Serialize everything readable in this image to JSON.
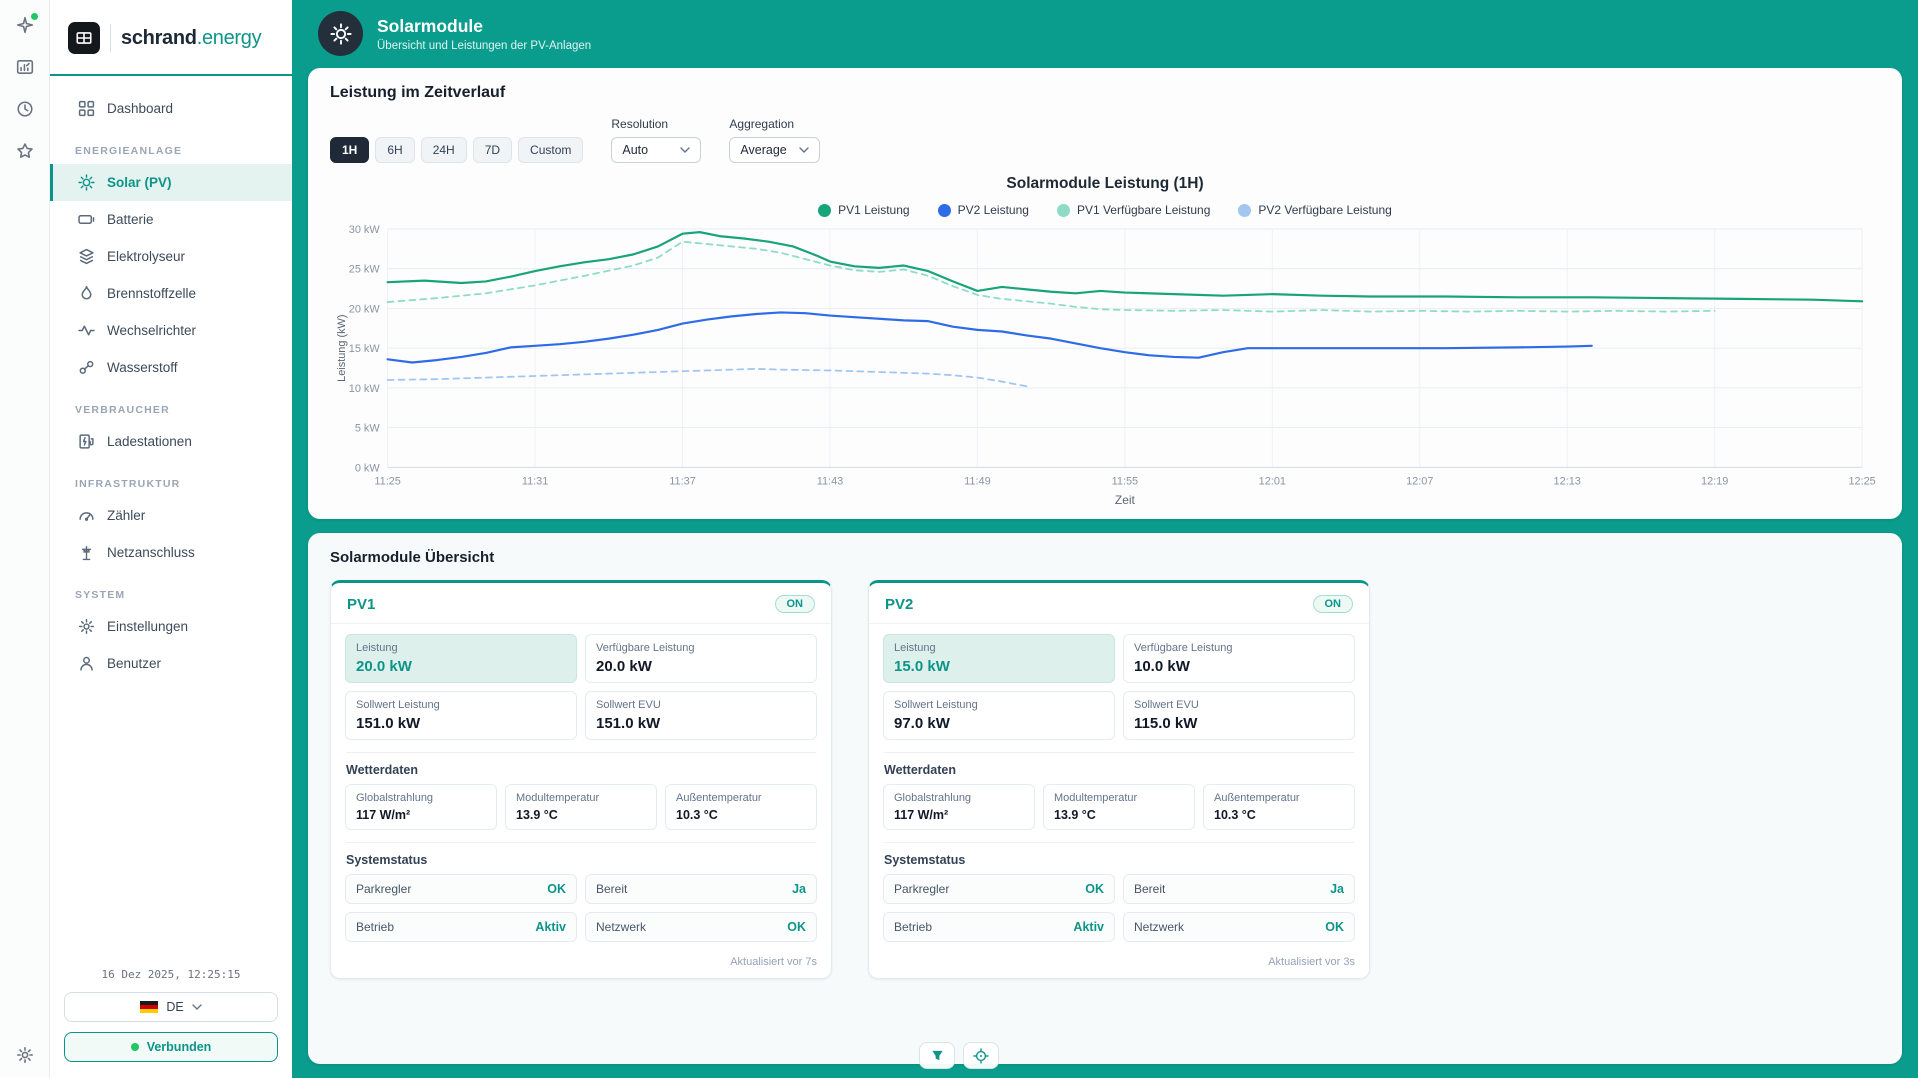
{
  "app": {
    "brand_primary": "schrand",
    "brand_secondary": ".energy",
    "timestamp": "16 Dez 2025, 12:25:15",
    "language": "DE",
    "connection_status": "Verbunden"
  },
  "colors": {
    "accent": "#0d9488",
    "main_bg": "#0a9d8d",
    "active_range_bg": "#1f2937",
    "status_ok": "#0d9488"
  },
  "sidebar": {
    "dashboard_label": "Dashboard",
    "sections": [
      {
        "title": "ENERGIEANLAGE",
        "items": [
          {
            "label": "Solar (PV)"
          },
          {
            "label": "Batterie"
          },
          {
            "label": "Elektrolyseur"
          },
          {
            "label": "Brennstoffzelle"
          },
          {
            "label": "Wechselrichter"
          },
          {
            "label": "Wasserstoff"
          }
        ]
      },
      {
        "title": "VERBRAUCHER",
        "items": [
          {
            "label": "Ladestationen"
          }
        ]
      },
      {
        "title": "INFRASTRUKTUR",
        "items": [
          {
            "label": "Zähler"
          },
          {
            "label": "Netzanschluss"
          }
        ]
      },
      {
        "title": "SYSTEM",
        "items": [
          {
            "label": "Einstellungen"
          },
          {
            "label": "Benutzer"
          }
        ]
      }
    ]
  },
  "header": {
    "title": "Solarmodule",
    "subtitle": "Übersicht und Leistungen der PV-Anlagen"
  },
  "chart_card": {
    "title": "Leistung im Zeitverlauf",
    "time_ranges": [
      "1H",
      "6H",
      "24H",
      "7D",
      "Custom"
    ],
    "active_range": "1H",
    "resolution_label": "Resolution",
    "resolution_value": "Auto",
    "aggregation_label": "Aggregation",
    "aggregation_value": "Average"
  },
  "chart_data": {
    "type": "line",
    "title": "Solarmodule Leistung (1H)",
    "xlabel": "Zeit",
    "ylabel": "Leistung (kW)",
    "ylim": [
      0,
      30
    ],
    "x_range": [
      0,
      60
    ],
    "grid": true,
    "legend_position": "top",
    "x_ticks": [
      {
        "v": 0,
        "label": "11:25"
      },
      {
        "v": 6,
        "label": "11:31"
      },
      {
        "v": 12,
        "label": "11:37"
      },
      {
        "v": 18,
        "label": "11:43"
      },
      {
        "v": 24,
        "label": "11:49"
      },
      {
        "v": 30,
        "label": "11:55"
      },
      {
        "v": 36,
        "label": "12:01"
      },
      {
        "v": 42,
        "label": "12:07"
      },
      {
        "v": 48,
        "label": "12:13"
      },
      {
        "v": 54,
        "label": "12:19"
      },
      {
        "v": 60,
        "label": "12:25"
      }
    ],
    "y_ticks": [
      {
        "v": 0,
        "label": "0 kW"
      },
      {
        "v": 5,
        "label": "5 kW"
      },
      {
        "v": 10,
        "label": "10 kW"
      },
      {
        "v": 15,
        "label": "15 kW"
      },
      {
        "v": 20,
        "label": "20 kW"
      },
      {
        "v": 25,
        "label": "25 kW"
      },
      {
        "v": 30,
        "label": "30 kW"
      }
    ],
    "series": [
      {
        "name": "PV1 Leistung",
        "color": "#18a478",
        "dashed": false,
        "points": [
          [
            0,
            23.3
          ],
          [
            1.5,
            23.5
          ],
          [
            3,
            23.2
          ],
          [
            4,
            23.4
          ],
          [
            5,
            24.0
          ],
          [
            6,
            24.7
          ],
          [
            7,
            25.3
          ],
          [
            8,
            25.8
          ],
          [
            9,
            26.2
          ],
          [
            10,
            26.8
          ],
          [
            11,
            27.8
          ],
          [
            12,
            29.4
          ],
          [
            12.7,
            29.6
          ],
          [
            13.5,
            29.1
          ],
          [
            14.5,
            28.8
          ],
          [
            15.5,
            28.4
          ],
          [
            16.5,
            27.8
          ],
          [
            17.5,
            26.6
          ],
          [
            18,
            25.9
          ],
          [
            19,
            25.3
          ],
          [
            20,
            25.1
          ],
          [
            21,
            25.4
          ],
          [
            22,
            24.7
          ],
          [
            23,
            23.4
          ],
          [
            24,
            22.2
          ],
          [
            25,
            22.7
          ],
          [
            26,
            22.4
          ],
          [
            27,
            22.1
          ],
          [
            28,
            21.9
          ],
          [
            29,
            22.2
          ],
          [
            30,
            22.0
          ],
          [
            32,
            21.8
          ],
          [
            34,
            21.6
          ],
          [
            36,
            21.8
          ],
          [
            38,
            21.6
          ],
          [
            40,
            21.5
          ],
          [
            43,
            21.5
          ],
          [
            46,
            21.4
          ],
          [
            49,
            21.4
          ],
          [
            52,
            21.3
          ],
          [
            55,
            21.2
          ],
          [
            58,
            21.1
          ],
          [
            60,
            20.9
          ]
        ]
      },
      {
        "name": "PV2 Leistung",
        "color": "#2e6be6",
        "dashed": false,
        "points": [
          [
            0,
            13.6
          ],
          [
            1,
            13.2
          ],
          [
            2,
            13.5
          ],
          [
            3,
            13.9
          ],
          [
            4,
            14.4
          ],
          [
            5,
            15.1
          ],
          [
            6,
            15.3
          ],
          [
            7,
            15.5
          ],
          [
            8,
            15.8
          ],
          [
            9,
            16.2
          ],
          [
            10,
            16.7
          ],
          [
            11,
            17.3
          ],
          [
            12,
            18.1
          ],
          [
            13,
            18.6
          ],
          [
            14,
            19.0
          ],
          [
            15,
            19.3
          ],
          [
            16,
            19.5
          ],
          [
            17,
            19.4
          ],
          [
            18,
            19.1
          ],
          [
            19,
            18.9
          ],
          [
            20,
            18.7
          ],
          [
            21,
            18.5
          ],
          [
            22,
            18.4
          ],
          [
            23,
            17.7
          ],
          [
            24,
            17.3
          ],
          [
            25,
            17.1
          ],
          [
            26,
            16.6
          ],
          [
            27,
            16.2
          ],
          [
            28,
            15.6
          ],
          [
            29,
            15.0
          ],
          [
            30,
            14.5
          ],
          [
            31,
            14.1
          ],
          [
            32,
            13.9
          ],
          [
            33,
            13.8
          ],
          [
            34,
            14.5
          ],
          [
            35,
            15.0
          ],
          [
            37,
            15.0
          ],
          [
            40,
            15.0
          ],
          [
            43,
            15.0
          ],
          [
            46,
            15.1
          ],
          [
            48,
            15.2
          ],
          [
            49,
            15.3
          ]
        ]
      },
      {
        "name": "PV1 Verfügbare Leistung",
        "color": "#8edbc7",
        "dashed": true,
        "points": [
          [
            0,
            20.8
          ],
          [
            2,
            21.3
          ],
          [
            4,
            21.9
          ],
          [
            6,
            22.9
          ],
          [
            8,
            24.1
          ],
          [
            10,
            25.4
          ],
          [
            11,
            26.4
          ],
          [
            12,
            28.4
          ],
          [
            13,
            28.1
          ],
          [
            14,
            27.8
          ],
          [
            15,
            27.5
          ],
          [
            16,
            27.0
          ],
          [
            17,
            26.2
          ],
          [
            18,
            25.4
          ],
          [
            19,
            24.8
          ],
          [
            20,
            24.6
          ],
          [
            21,
            24.9
          ],
          [
            22,
            24.1
          ],
          [
            23,
            22.8
          ],
          [
            24,
            21.7
          ],
          [
            25,
            21.2
          ],
          [
            26,
            20.9
          ],
          [
            27,
            20.6
          ],
          [
            28,
            20.2
          ],
          [
            29,
            19.9
          ],
          [
            30,
            19.8
          ],
          [
            32,
            19.7
          ],
          [
            34,
            19.8
          ],
          [
            36,
            19.6
          ],
          [
            38,
            19.8
          ],
          [
            40,
            19.6
          ],
          [
            42,
            19.7
          ],
          [
            44,
            19.6
          ],
          [
            46,
            19.7
          ],
          [
            48,
            19.6
          ],
          [
            50,
            19.7
          ],
          [
            52,
            19.6
          ],
          [
            54,
            19.7
          ]
        ]
      },
      {
        "name": "PV2 Verfügbare Leistung",
        "color": "#a2c6f0",
        "dashed": true,
        "points": [
          [
            0,
            11.0
          ],
          [
            2,
            11.1
          ],
          [
            4,
            11.3
          ],
          [
            6,
            11.5
          ],
          [
            8,
            11.7
          ],
          [
            10,
            11.9
          ],
          [
            12,
            12.1
          ],
          [
            14,
            12.3
          ],
          [
            15,
            12.4
          ],
          [
            16,
            12.3
          ],
          [
            18,
            12.2
          ],
          [
            20,
            12.0
          ],
          [
            22,
            11.8
          ],
          [
            23,
            11.6
          ],
          [
            24,
            11.3
          ],
          [
            25,
            10.8
          ],
          [
            26,
            10.2
          ]
        ]
      }
    ]
  },
  "overview": {
    "title": "Solarmodule Übersicht",
    "cards": [
      {
        "name": "PV1",
        "status": "ON",
        "metrics": [
          {
            "label": "Leistung",
            "value": "20.0 kW"
          },
          {
            "label": "Verfügbare Leistung",
            "value": "20.0 kW"
          },
          {
            "label": "Sollwert Leistung",
            "value": "151.0 kW"
          },
          {
            "label": "Sollwert EVU",
            "value": "151.0 kW"
          }
        ],
        "weather_title": "Wetterdaten",
        "weather": [
          {
            "label": "Globalstrahlung",
            "value": "117 W/m²"
          },
          {
            "label": "Modultemperatur",
            "value": "13.9 °C"
          },
          {
            "label": "Außentemperatur",
            "value": "10.3 °C"
          }
        ],
        "system_title": "Systemstatus",
        "system": [
          {
            "label": "Parkregler",
            "value": "OK"
          },
          {
            "label": "Bereit",
            "value": "Ja"
          },
          {
            "label": "Betrieb",
            "value": "Aktiv"
          },
          {
            "label": "Netzwerk",
            "value": "OK"
          }
        ],
        "updated": "Aktualisiert vor 7s"
      },
      {
        "name": "PV2",
        "status": "ON",
        "metrics": [
          {
            "label": "Leistung",
            "value": "15.0 kW"
          },
          {
            "label": "Verfügbare Leistung",
            "value": "10.0 kW"
          },
          {
            "label": "Sollwert Leistung",
            "value": "97.0 kW"
          },
          {
            "label": "Sollwert EVU",
            "value": "115.0 kW"
          }
        ],
        "weather_title": "Wetterdaten",
        "weather": [
          {
            "label": "Globalstrahlung",
            "value": "117 W/m²"
          },
          {
            "label": "Modultemperatur",
            "value": "13.9 °C"
          },
          {
            "label": "Außentemperatur",
            "value": "10.3 °C"
          }
        ],
        "system_title": "Systemstatus",
        "system": [
          {
            "label": "Parkregler",
            "value": "OK"
          },
          {
            "label": "Bereit",
            "value": "Ja"
          },
          {
            "label": "Betrieb",
            "value": "Aktiv"
          },
          {
            "label": "Netzwerk",
            "value": "OK"
          }
        ],
        "updated": "Aktualisiert vor 3s"
      }
    ]
  }
}
